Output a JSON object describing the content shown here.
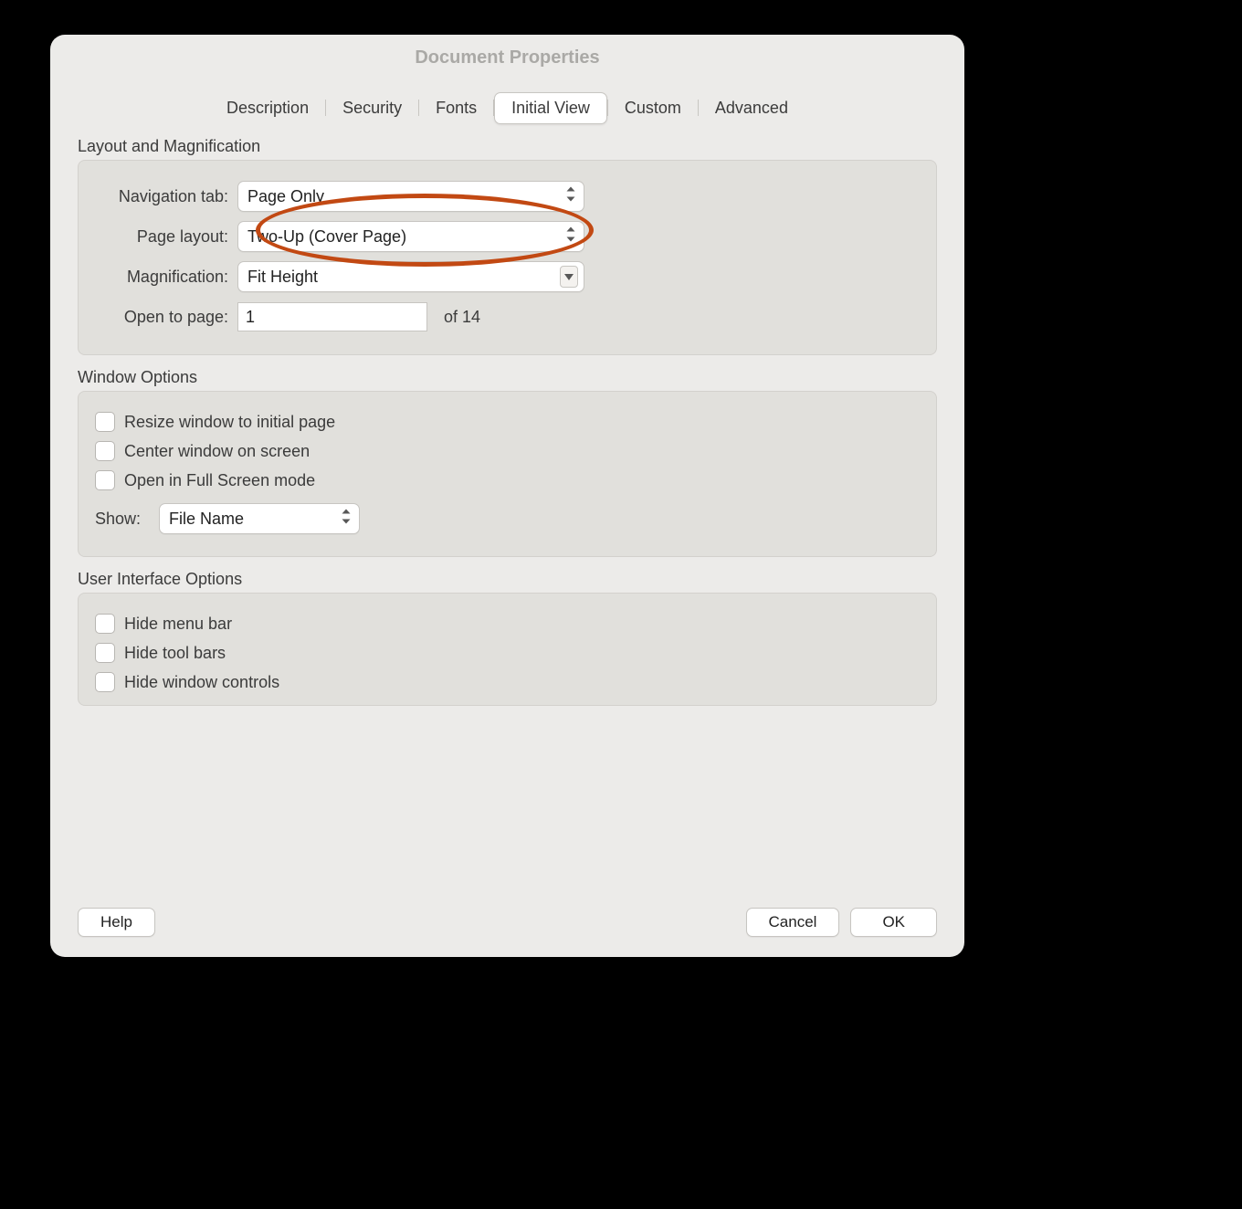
{
  "window_title": "Document Properties",
  "tabs": {
    "description": "Description",
    "security": "Security",
    "fonts": "Fonts",
    "initial_view": "Initial View",
    "custom": "Custom",
    "advanced": "Advanced"
  },
  "layout_section": {
    "heading": "Layout and Magnification",
    "navigation_tab_label": "Navigation tab:",
    "navigation_tab_value": "Page Only",
    "page_layout_label": "Page layout:",
    "page_layout_value": "Two-Up (Cover Page)",
    "magnification_label": "Magnification:",
    "magnification_value": "Fit Height",
    "open_to_page_label": "Open to page:",
    "open_to_page_value": "1",
    "open_to_page_of": "of 14"
  },
  "window_section": {
    "heading": "Window Options",
    "resize": "Resize window to initial page",
    "center": "Center window on screen",
    "fullscreen": "Open in Full Screen mode",
    "show_label": "Show:",
    "show_value": "File Name"
  },
  "ui_section": {
    "heading": "User Interface Options",
    "hide_menu": "Hide menu bar",
    "hide_tool": "Hide tool bars",
    "hide_wc": "Hide window controls"
  },
  "buttons": {
    "help": "Help",
    "cancel": "Cancel",
    "ok": "OK"
  }
}
